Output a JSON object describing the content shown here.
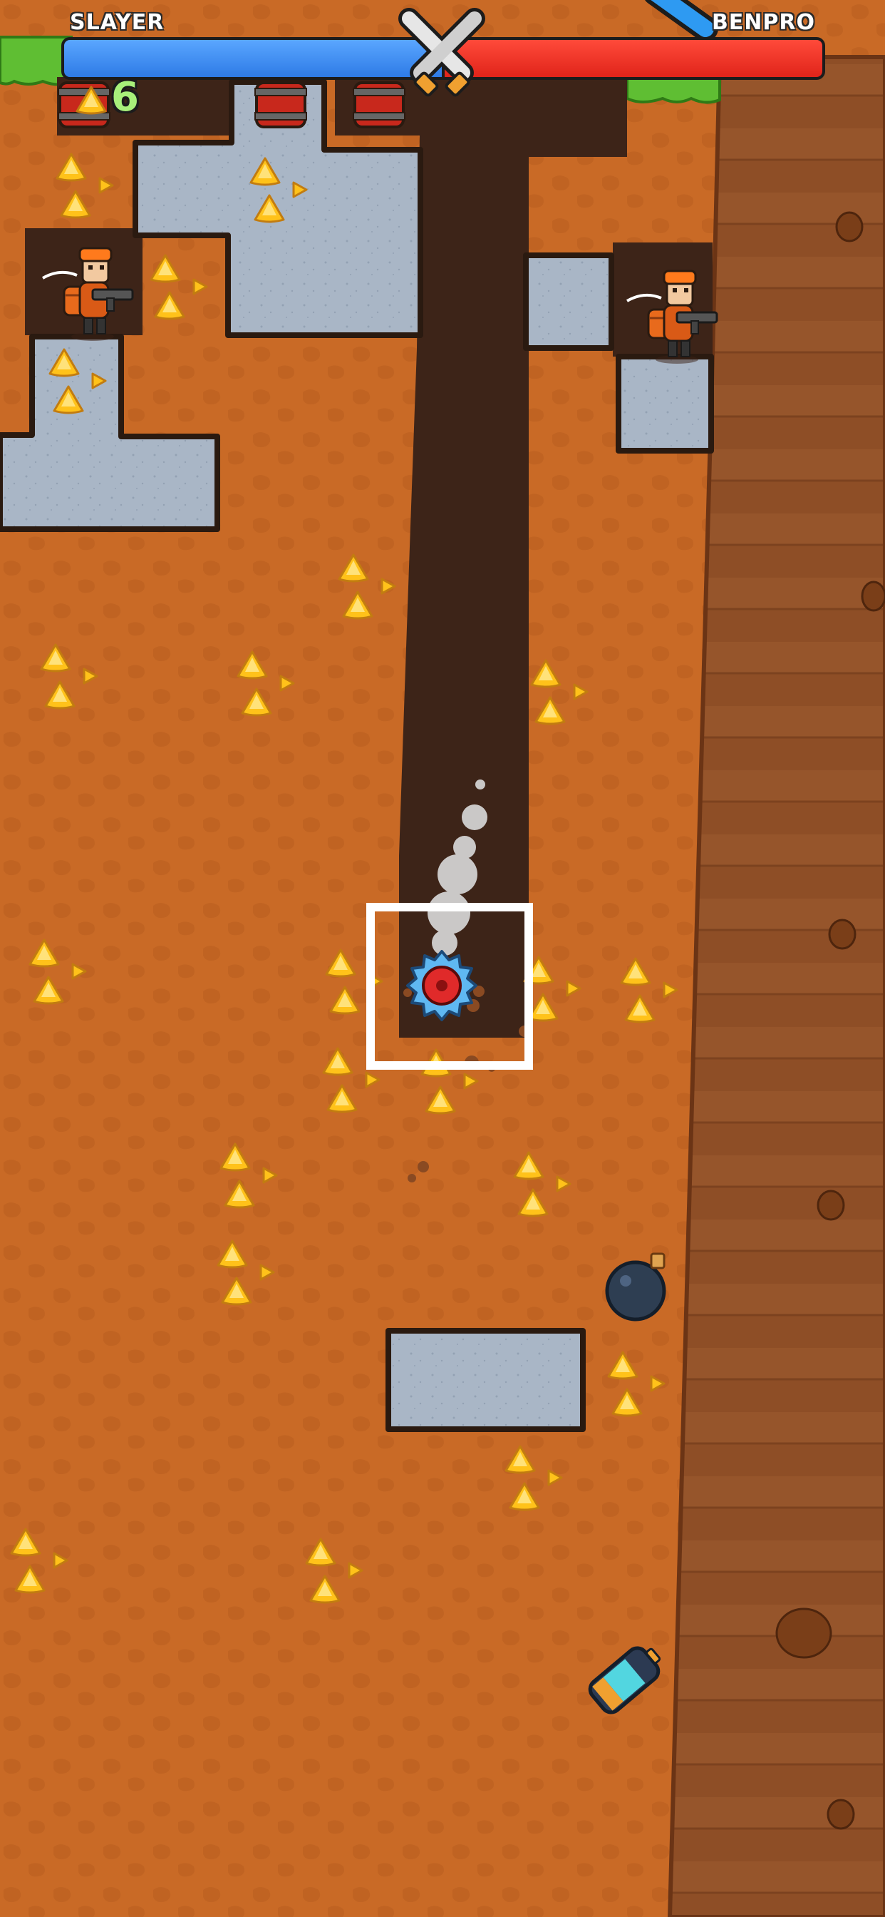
{
  "hud": {
    "player_left_name": "SLAYER",
    "player_right_name": "BENPRO",
    "player_left_color": "#2e7be6",
    "player_right_color": "#e0241a",
    "gold_count": "6",
    "center_icon": "crossed-swords-icon"
  },
  "world": {
    "dirt_color": "#c96a26",
    "rock_color": "#a8b5c4",
    "tunnel_color": "#3d2418",
    "wall_color": "#8a4a22"
  },
  "items": {
    "bomb_icon": "bomb-icon",
    "battery_icon": "battery-icon",
    "barrel_icon": "explosive-barrel-icon",
    "drill_icon": "saw-drill-icon",
    "gold_icon": "gold-nugget-icon",
    "enemy_icon": "miner-gunner-icon"
  }
}
